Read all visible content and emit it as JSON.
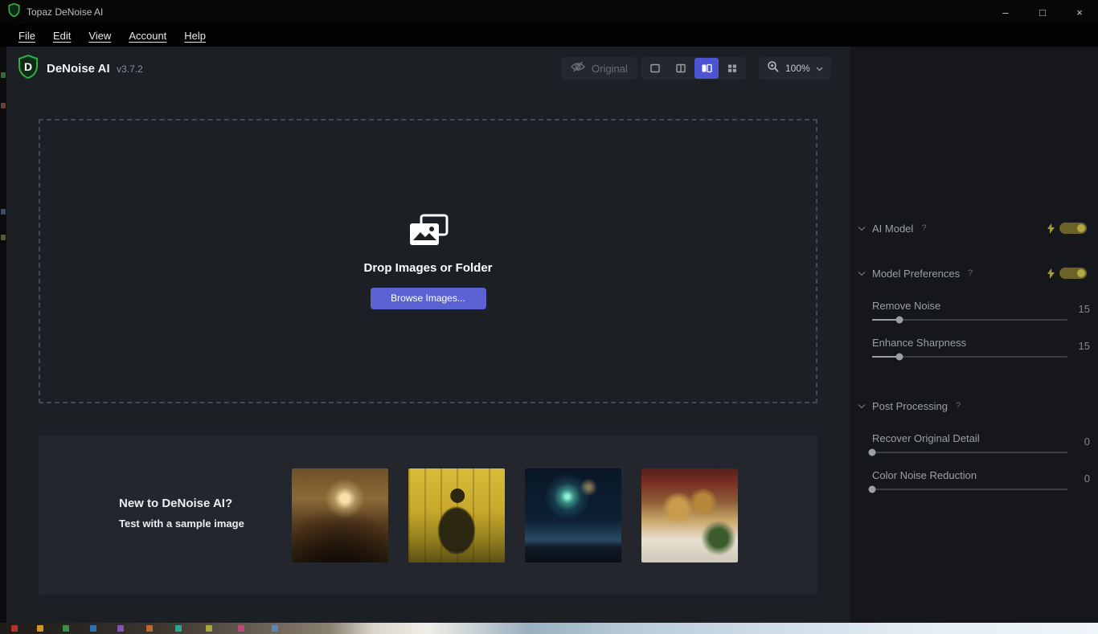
{
  "titlebar": {
    "title": "Topaz DeNoise AI",
    "controls": {
      "minimize": "–",
      "maximize": "□",
      "close": "×"
    }
  },
  "menu": {
    "items": [
      {
        "label": "File"
      },
      {
        "label": "Edit"
      },
      {
        "label": "View"
      },
      {
        "label": "Account"
      },
      {
        "label": "Help"
      }
    ]
  },
  "header": {
    "app_name": "DeNoise AI",
    "version": "v3.7.2"
  },
  "toolbar": {
    "original_label": "Original",
    "zoom_value": "100%"
  },
  "dropzone": {
    "title": "Drop Images or Folder",
    "browse_button": "Browse Images..."
  },
  "samples": {
    "heading": "New to DeNoise AI?",
    "subheading": "Test with a sample image",
    "thumbnails": [
      {
        "name": "wooden-interior"
      },
      {
        "name": "stained-glass-silhouette"
      },
      {
        "name": "fireworks-night"
      },
      {
        "name": "hanging-baskets-cafe"
      }
    ]
  },
  "sidebar": {
    "sections": {
      "ai_model": {
        "label": "AI Model",
        "help": "?"
      },
      "model_preferences": {
        "label": "Model Preferences",
        "help": "?"
      },
      "post_processing": {
        "label": "Post Processing",
        "help": "?"
      }
    },
    "sliders": [
      {
        "label": "Remove Noise",
        "value": "15",
        "percent": 14
      },
      {
        "label": "Enhance Sharpness",
        "value": "15",
        "percent": 14
      },
      {
        "label": "Recover Original Detail",
        "value": "0",
        "percent": 0
      },
      {
        "label": "Color Noise Reduction",
        "value": "0",
        "percent": 0
      }
    ]
  },
  "colors": {
    "accent_button": "#5b63d3",
    "selected_view": "#4c54d2",
    "toggle_on": "#6b6329",
    "logo_green": "#2fae47",
    "main_bg": "#1c1f24",
    "panel_bg": "#15171a"
  }
}
